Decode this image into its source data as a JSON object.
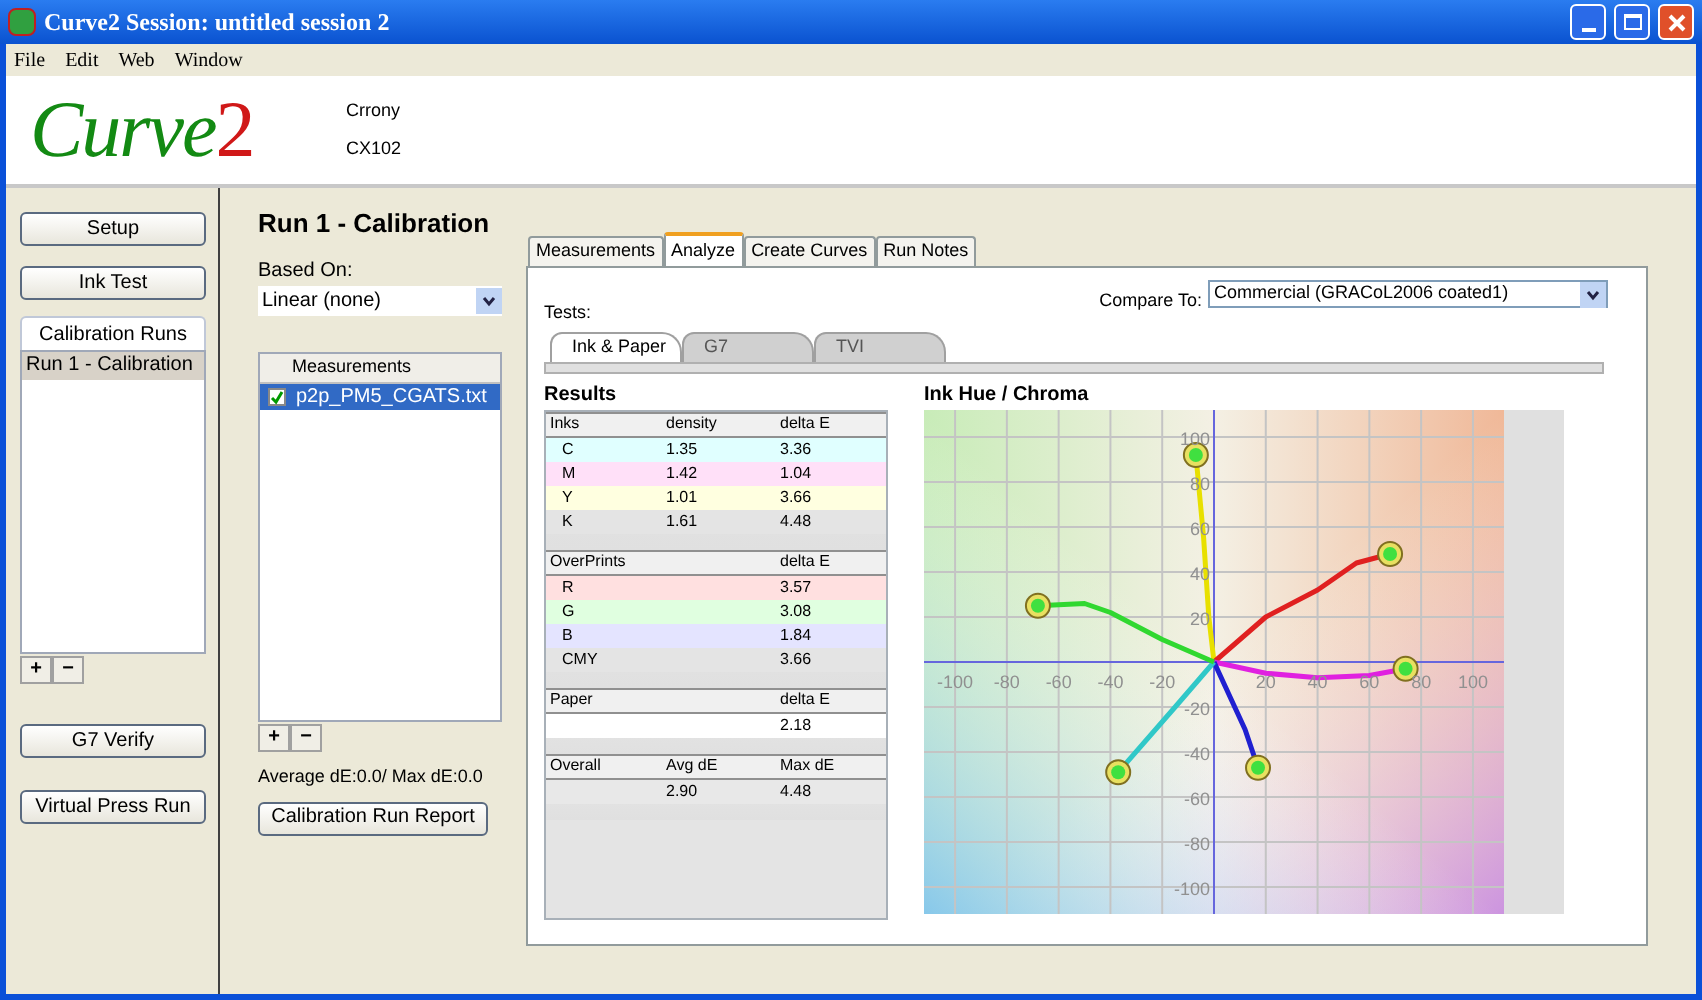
{
  "window": {
    "title": "Curve2 Session: untitled session 2"
  },
  "menu": [
    "File",
    "Edit",
    "Web",
    "Window"
  ],
  "header": {
    "logo_main": "Curve",
    "logo_digit": "2",
    "lines": [
      "Crrony",
      "CX102"
    ]
  },
  "sidebar": {
    "buttons_top": [
      "Setup",
      "Ink Test"
    ],
    "runs_tab": "Calibration Runs",
    "runs": [
      {
        "label": "Run 1 - Calibration",
        "selected": true
      }
    ],
    "list_buttons": [
      "+",
      "−"
    ],
    "buttons_bottom": [
      "G7 Verify",
      "Virtual Press Run"
    ]
  },
  "run": {
    "title": "Run 1 - Calibration",
    "based_on_label": "Based On:",
    "based_on_value": "Linear (none)",
    "measurements_header": "Measurements",
    "measurements": [
      {
        "label": "p2p_PM5_CGATS.txt",
        "checked": true,
        "selected": true
      }
    ],
    "list_buttons": [
      "+",
      "−"
    ],
    "summary": "Average dE:0.0/ Max dE:0.0",
    "report_button": "Calibration Run Report"
  },
  "tabs": [
    {
      "label": "Measurements",
      "selected": false
    },
    {
      "label": "Analyze",
      "selected": true
    },
    {
      "label": "Create Curves",
      "selected": false
    },
    {
      "label": "Run Notes",
      "selected": false
    }
  ],
  "analyze": {
    "tests_label": "Tests:",
    "compare_label": "Compare To:",
    "compare_value": "Commercial (GRACoL2006 coated1)",
    "test_tabs": [
      {
        "label": "Ink & Paper",
        "selected": true
      },
      {
        "label": "G7",
        "selected": false
      },
      {
        "label": "TVI",
        "selected": false
      }
    ],
    "results_title": "Results",
    "sections": [
      {
        "columns": [
          "Inks",
          "density",
          "delta E"
        ],
        "rows": [
          {
            "cells": [
              "C",
              "1.35",
              "3.36"
            ],
            "color": "#e0ffff"
          },
          {
            "cells": [
              "M",
              "1.42",
              "1.04"
            ],
            "color": "#ffe0f8"
          },
          {
            "cells": [
              "Y",
              "1.01",
              "3.66"
            ],
            "color": "#ffffe0"
          },
          {
            "cells": [
              "K",
              "1.61",
              "4.48"
            ],
            "color": "#e4e4e4"
          }
        ]
      },
      {
        "columns": [
          "OverPrints",
          "",
          "delta E"
        ],
        "rows": [
          {
            "cells": [
              "R",
              "",
              "3.57"
            ],
            "color": "#ffe0e0"
          },
          {
            "cells": [
              "G",
              "",
              "3.08"
            ],
            "color": "#e0ffe0"
          },
          {
            "cells": [
              "B",
              "",
              "1.84"
            ],
            "color": "#e4e4ff"
          },
          {
            "cells": [
              "CMY",
              "",
              "3.66"
            ],
            "color": "#e4e4e4"
          }
        ]
      },
      {
        "columns": [
          "Paper",
          "",
          "delta E"
        ],
        "rows": [
          {
            "cells": [
              "",
              "",
              "2.18"
            ],
            "color": "#ffffff"
          }
        ]
      },
      {
        "columns": [
          "Overall",
          "Avg dE",
          "Max dE"
        ],
        "rows": [
          {
            "cells": [
              "",
              "2.90",
              "4.48"
            ],
            "color": "#e8e8e8"
          }
        ]
      }
    ],
    "chart_title": "Ink Hue / Chroma",
    "chart_data": {
      "type": "line",
      "grid": true,
      "xlim": [
        -112,
        112
      ],
      "ylim": [
        -112,
        112
      ],
      "xticks": [
        -100,
        -80,
        -60,
        -40,
        -20,
        20,
        40,
        60,
        80,
        100
      ],
      "yticks": [
        -100,
        -80,
        -60,
        -40,
        -20,
        20,
        40,
        60,
        80,
        100
      ],
      "series": [
        {
          "color": "#e8e000",
          "x": [
            0,
            -2,
            -4,
            -7
          ],
          "values": [
            0,
            20,
            55,
            92
          ]
        },
        {
          "color": "#e02020",
          "x": [
            0,
            20,
            40,
            55,
            68
          ],
          "values": [
            0,
            20,
            32,
            44,
            48
          ]
        },
        {
          "color": "#e020e0",
          "x": [
            0,
            20,
            40,
            60,
            74
          ],
          "values": [
            0,
            -5,
            -7,
            -6,
            -3
          ]
        },
        {
          "color": "#2020d0",
          "x": [
            0,
            8,
            12,
            17
          ],
          "values": [
            0,
            -20,
            -30,
            -47
          ]
        },
        {
          "color": "#30c8c8",
          "x": [
            0,
            -15,
            -37
          ],
          "values": [
            0,
            -20,
            -49
          ]
        },
        {
          "color": "#30d830",
          "x": [
            0,
            -20,
            -40,
            -50,
            -68
          ],
          "values": [
            0,
            10,
            22,
            26,
            25
          ]
        }
      ]
    }
  }
}
